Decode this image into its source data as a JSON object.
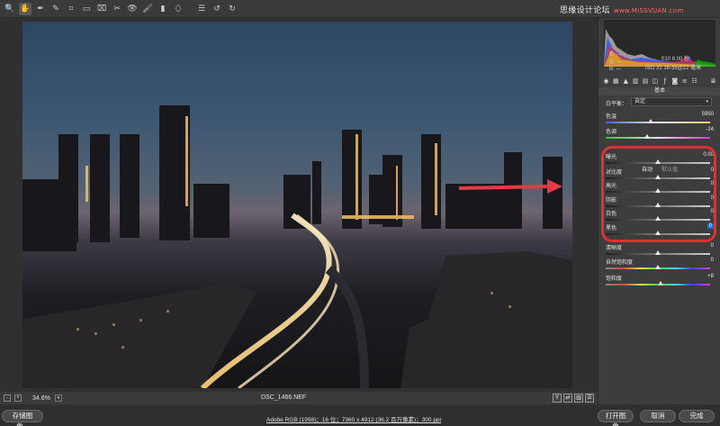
{
  "toolbar": {
    "tools": [
      "zoom-icon",
      "hand-icon",
      "white-balance-icon",
      "color-sampler-icon",
      "crop-icon",
      "straighten-icon",
      "transform-icon",
      "spot-removal-icon",
      "red-eye-icon",
      "brush-icon",
      "graduated-filter-icon",
      "radial-filter-icon",
      "preferences-icon",
      "rotate-left-icon",
      "rotate-right-icon"
    ],
    "glyphs": [
      "🔍",
      "✋",
      "✒",
      "✎",
      "⌗",
      "▭",
      "⌧",
      "✂",
      "👁",
      "🖌",
      "▮",
      "⬯",
      "☰",
      "↺",
      "↻"
    ]
  },
  "watermark": {
    "text": "思缘设计论坛",
    "url": "www.MISSVUAN.com"
  },
  "status": {
    "zoom": "34.6%",
    "filename": "DSC_1466.NEF",
    "minus": "-",
    "plus": "+"
  },
  "bottom": {
    "save_label": "存储图像...",
    "workflow": "Adobe RGB (1998)；16 位；7360 x 4912 (36.2 百万像素)；300 ppi",
    "open_label": "打开图像",
    "cancel_label": "取消",
    "done_label": "完成"
  },
  "camera": {
    "r": "R:  ---",
    "g": "G:  ---",
    "b": "B:  ---",
    "aperture_shutter": "f/10    8.00 秒",
    "iso_lens": "ISO 31    16-35@22 毫米"
  },
  "panel": {
    "section_title": "基本",
    "wb_label": "白平衡：",
    "wb_value": "自定",
    "auto_label": "自动",
    "default_label": "默认值",
    "sliders": [
      {
        "label": "色温",
        "value": "5950",
        "level": 0.43
      },
      {
        "label": "色调",
        "value": "-24",
        "level": 0.4
      },
      {
        "label": "曝光",
        "value": "0.00",
        "level": 0.5
      },
      {
        "label": "对比度",
        "value": "0",
        "level": 0.5
      },
      {
        "label": "高光",
        "value": "0",
        "level": 0.5
      },
      {
        "label": "阴影",
        "value": "0",
        "level": 0.5
      },
      {
        "label": "白色",
        "value": "0",
        "level": 0.5
      },
      {
        "label": "黑色",
        "value": "0",
        "level": 0.5,
        "editing": true
      },
      {
        "label": "清晰度",
        "value": "0",
        "level": 0.5
      },
      {
        "label": "自然饱和度",
        "value": "0",
        "level": 0.5
      },
      {
        "label": "饱和度",
        "value": "+8",
        "level": 0.53
      }
    ]
  },
  "colors": {
    "highlight": "#e23030",
    "arrow": "#e23b44",
    "selected_value": "#1c6fd6"
  }
}
